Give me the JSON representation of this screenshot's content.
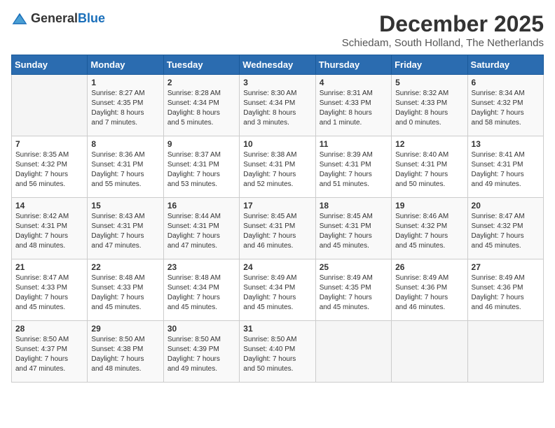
{
  "header": {
    "logo_general": "General",
    "logo_blue": "Blue",
    "month": "December 2025",
    "location": "Schiedam, South Holland, The Netherlands"
  },
  "columns": [
    "Sunday",
    "Monday",
    "Tuesday",
    "Wednesday",
    "Thursday",
    "Friday",
    "Saturday"
  ],
  "weeks": [
    [
      {
        "day": "",
        "content": ""
      },
      {
        "day": "1",
        "content": "Sunrise: 8:27 AM\nSunset: 4:35 PM\nDaylight: 8 hours\nand 7 minutes."
      },
      {
        "day": "2",
        "content": "Sunrise: 8:28 AM\nSunset: 4:34 PM\nDaylight: 8 hours\nand 5 minutes."
      },
      {
        "day": "3",
        "content": "Sunrise: 8:30 AM\nSunset: 4:34 PM\nDaylight: 8 hours\nand 3 minutes."
      },
      {
        "day": "4",
        "content": "Sunrise: 8:31 AM\nSunset: 4:33 PM\nDaylight: 8 hours\nand 1 minute."
      },
      {
        "day": "5",
        "content": "Sunrise: 8:32 AM\nSunset: 4:33 PM\nDaylight: 8 hours\nand 0 minutes."
      },
      {
        "day": "6",
        "content": "Sunrise: 8:34 AM\nSunset: 4:32 PM\nDaylight: 7 hours\nand 58 minutes."
      }
    ],
    [
      {
        "day": "7",
        "content": "Sunrise: 8:35 AM\nSunset: 4:32 PM\nDaylight: 7 hours\nand 56 minutes."
      },
      {
        "day": "8",
        "content": "Sunrise: 8:36 AM\nSunset: 4:31 PM\nDaylight: 7 hours\nand 55 minutes."
      },
      {
        "day": "9",
        "content": "Sunrise: 8:37 AM\nSunset: 4:31 PM\nDaylight: 7 hours\nand 53 minutes."
      },
      {
        "day": "10",
        "content": "Sunrise: 8:38 AM\nSunset: 4:31 PM\nDaylight: 7 hours\nand 52 minutes."
      },
      {
        "day": "11",
        "content": "Sunrise: 8:39 AM\nSunset: 4:31 PM\nDaylight: 7 hours\nand 51 minutes."
      },
      {
        "day": "12",
        "content": "Sunrise: 8:40 AM\nSunset: 4:31 PM\nDaylight: 7 hours\nand 50 minutes."
      },
      {
        "day": "13",
        "content": "Sunrise: 8:41 AM\nSunset: 4:31 PM\nDaylight: 7 hours\nand 49 minutes."
      }
    ],
    [
      {
        "day": "14",
        "content": "Sunrise: 8:42 AM\nSunset: 4:31 PM\nDaylight: 7 hours\nand 48 minutes."
      },
      {
        "day": "15",
        "content": "Sunrise: 8:43 AM\nSunset: 4:31 PM\nDaylight: 7 hours\nand 47 minutes."
      },
      {
        "day": "16",
        "content": "Sunrise: 8:44 AM\nSunset: 4:31 PM\nDaylight: 7 hours\nand 47 minutes."
      },
      {
        "day": "17",
        "content": "Sunrise: 8:45 AM\nSunset: 4:31 PM\nDaylight: 7 hours\nand 46 minutes."
      },
      {
        "day": "18",
        "content": "Sunrise: 8:45 AM\nSunset: 4:31 PM\nDaylight: 7 hours\nand 45 minutes."
      },
      {
        "day": "19",
        "content": "Sunrise: 8:46 AM\nSunset: 4:32 PM\nDaylight: 7 hours\nand 45 minutes."
      },
      {
        "day": "20",
        "content": "Sunrise: 8:47 AM\nSunset: 4:32 PM\nDaylight: 7 hours\nand 45 minutes."
      }
    ],
    [
      {
        "day": "21",
        "content": "Sunrise: 8:47 AM\nSunset: 4:33 PM\nDaylight: 7 hours\nand 45 minutes."
      },
      {
        "day": "22",
        "content": "Sunrise: 8:48 AM\nSunset: 4:33 PM\nDaylight: 7 hours\nand 45 minutes."
      },
      {
        "day": "23",
        "content": "Sunrise: 8:48 AM\nSunset: 4:34 PM\nDaylight: 7 hours\nand 45 minutes."
      },
      {
        "day": "24",
        "content": "Sunrise: 8:49 AM\nSunset: 4:34 PM\nDaylight: 7 hours\nand 45 minutes."
      },
      {
        "day": "25",
        "content": "Sunrise: 8:49 AM\nSunset: 4:35 PM\nDaylight: 7 hours\nand 45 minutes."
      },
      {
        "day": "26",
        "content": "Sunrise: 8:49 AM\nSunset: 4:36 PM\nDaylight: 7 hours\nand 46 minutes."
      },
      {
        "day": "27",
        "content": "Sunrise: 8:49 AM\nSunset: 4:36 PM\nDaylight: 7 hours\nand 46 minutes."
      }
    ],
    [
      {
        "day": "28",
        "content": "Sunrise: 8:50 AM\nSunset: 4:37 PM\nDaylight: 7 hours\nand 47 minutes."
      },
      {
        "day": "29",
        "content": "Sunrise: 8:50 AM\nSunset: 4:38 PM\nDaylight: 7 hours\nand 48 minutes."
      },
      {
        "day": "30",
        "content": "Sunrise: 8:50 AM\nSunset: 4:39 PM\nDaylight: 7 hours\nand 49 minutes."
      },
      {
        "day": "31",
        "content": "Sunrise: 8:50 AM\nSunset: 4:40 PM\nDaylight: 7 hours\nand 50 minutes."
      },
      {
        "day": "",
        "content": ""
      },
      {
        "day": "",
        "content": ""
      },
      {
        "day": "",
        "content": ""
      }
    ]
  ]
}
